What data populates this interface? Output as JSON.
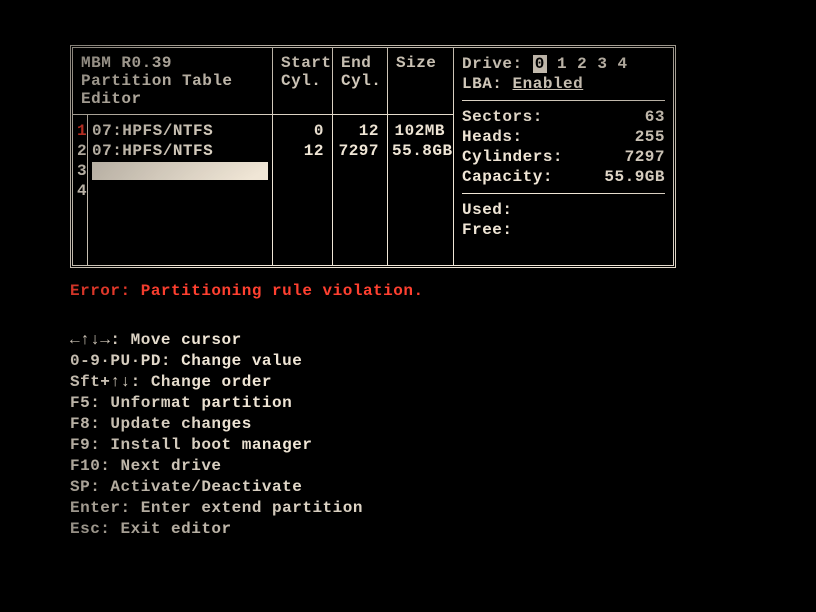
{
  "title": {
    "line1": "MBM R0.39",
    "line2": "Partition Table Editor"
  },
  "columns": {
    "start": {
      "l1": "Start",
      "l2": "Cyl."
    },
    "end": {
      "l1": "End",
      "l2": "Cyl."
    },
    "size": {
      "l1": "Size",
      "l2": ""
    }
  },
  "partitions": [
    {
      "idx": "1",
      "active": true,
      "type": "07:HPFS/NTFS",
      "start": "0",
      "end": "12",
      "size": "102MB"
    },
    {
      "idx": "2",
      "active": false,
      "type": "07:HPFS/NTFS",
      "start": "12",
      "end": "7297",
      "size": "55.8GB"
    },
    {
      "idx": "3",
      "active": false,
      "type": "",
      "start": "",
      "end": "",
      "size": ""
    },
    {
      "idx": "4",
      "active": false,
      "type": "",
      "start": "",
      "end": "",
      "size": ""
    }
  ],
  "drive": {
    "label": "Drive:",
    "selected": "0",
    "others": "1 2 3 4",
    "lba_label": "LBA:",
    "lba_value": "Enabled"
  },
  "geom": {
    "sectors": {
      "k": "Sectors:",
      "v": "63"
    },
    "heads": {
      "k": "Heads:",
      "v": "255"
    },
    "cylinders": {
      "k": "Cylinders:",
      "v": "7297"
    },
    "capacity": {
      "k": "Capacity:",
      "v": "55.9GB"
    }
  },
  "usage": {
    "used": {
      "k": "Used:",
      "v": ""
    },
    "free": {
      "k": "Free:",
      "v": ""
    }
  },
  "error": "Error: Partitioning rule violation.",
  "help": {
    "l0": "←↑↓→: Move cursor",
    "l1": "0-9·PU·PD: Change value",
    "l2": "Sft+↑↓: Change order",
    "l3": "F5: Unformat partition",
    "l4": "F8: Update changes",
    "l5": "F9: Install boot manager",
    "l6": "F10: Next drive",
    "l7": "SP: Activate/Deactivate",
    "l8": "Enter: Enter extend partition",
    "l9": "Esc: Exit editor"
  }
}
